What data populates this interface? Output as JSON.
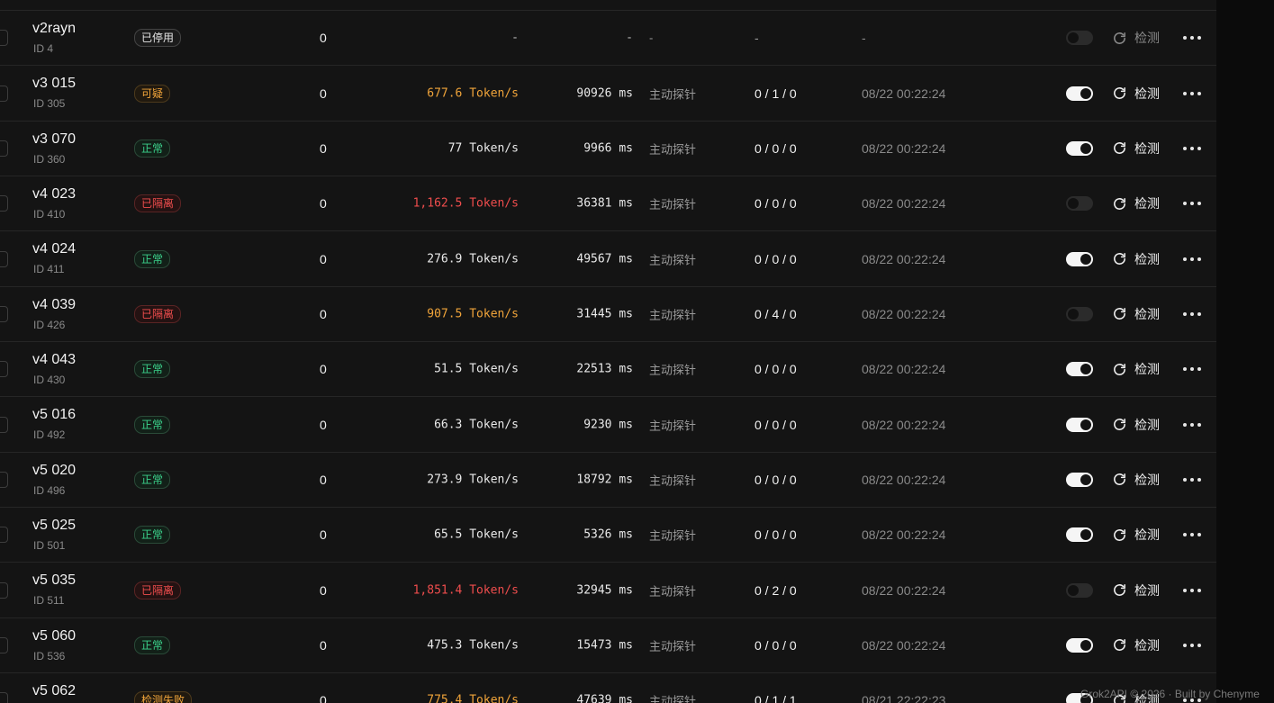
{
  "accounts": [
    {
      "name": "v2rayn",
      "id": "ID 4",
      "status": "已停用",
      "status_kind": "off",
      "count": "0",
      "speed": "-",
      "speed_kind": "dim",
      "latency": "-",
      "latency_kind": "dim",
      "method": "-",
      "ratio": "-",
      "ratio_kind": "dim",
      "time": "-",
      "enabled": false,
      "check_label": "检测",
      "check_disabled": true
    },
    {
      "name": "v3 015",
      "id": "ID 305",
      "status": "可疑",
      "status_kind": "sus",
      "count": "0",
      "speed": "677.6 Token/s",
      "speed_kind": "warn",
      "latency": "90926 ms",
      "latency_kind": "",
      "method": "主动探针",
      "ratio": "0 / 1 / 0",
      "ratio_kind": "",
      "time": "08/22 00:22:24",
      "enabled": true,
      "check_label": "检测",
      "check_disabled": false
    },
    {
      "name": "v3 070",
      "id": "ID 360",
      "status": "正常",
      "status_kind": "ok",
      "count": "0",
      "speed": "77 Token/s",
      "speed_kind": "",
      "latency": "9966 ms",
      "latency_kind": "",
      "method": "主动探针",
      "ratio": "0 / 0 / 0",
      "ratio_kind": "",
      "time": "08/22 00:22:24",
      "enabled": true,
      "check_label": "检测",
      "check_disabled": false
    },
    {
      "name": "v4 023",
      "id": "ID 410",
      "status": "已隔离",
      "status_kind": "iso",
      "count": "0",
      "speed": "1,162.5 Token/s",
      "speed_kind": "bad",
      "latency": "36381 ms",
      "latency_kind": "",
      "method": "主动探针",
      "ratio": "0 / 0 / 0",
      "ratio_kind": "",
      "time": "08/22 00:22:24",
      "enabled": false,
      "check_label": "检测",
      "check_disabled": false
    },
    {
      "name": "v4 024",
      "id": "ID 411",
      "status": "正常",
      "status_kind": "ok",
      "count": "0",
      "speed": "276.9 Token/s",
      "speed_kind": "",
      "latency": "49567 ms",
      "latency_kind": "",
      "method": "主动探针",
      "ratio": "0 / 0 / 0",
      "ratio_kind": "",
      "time": "08/22 00:22:24",
      "enabled": true,
      "check_label": "检测",
      "check_disabled": false
    },
    {
      "name": "v4 039",
      "id": "ID 426",
      "status": "已隔离",
      "status_kind": "iso",
      "count": "0",
      "speed": "907.5 Token/s",
      "speed_kind": "warn",
      "latency": "31445 ms",
      "latency_kind": "",
      "method": "主动探针",
      "ratio": "0 / 4 / 0",
      "ratio_kind": "",
      "time": "08/22 00:22:24",
      "enabled": false,
      "check_label": "检测",
      "check_disabled": false
    },
    {
      "name": "v4 043",
      "id": "ID 430",
      "status": "正常",
      "status_kind": "ok",
      "count": "0",
      "speed": "51.5 Token/s",
      "speed_kind": "",
      "latency": "22513 ms",
      "latency_kind": "",
      "method": "主动探针",
      "ratio": "0 / 0 / 0",
      "ratio_kind": "",
      "time": "08/22 00:22:24",
      "enabled": true,
      "check_label": "检测",
      "check_disabled": false
    },
    {
      "name": "v5 016",
      "id": "ID 492",
      "status": "正常",
      "status_kind": "ok",
      "count": "0",
      "speed": "66.3 Token/s",
      "speed_kind": "",
      "latency": "9230 ms",
      "latency_kind": "",
      "method": "主动探针",
      "ratio": "0 / 0 / 0",
      "ratio_kind": "",
      "time": "08/22 00:22:24",
      "enabled": true,
      "check_label": "检测",
      "check_disabled": false
    },
    {
      "name": "v5 020",
      "id": "ID 496",
      "status": "正常",
      "status_kind": "ok",
      "count": "0",
      "speed": "273.9 Token/s",
      "speed_kind": "",
      "latency": "18792 ms",
      "latency_kind": "",
      "method": "主动探针",
      "ratio": "0 / 0 / 0",
      "ratio_kind": "",
      "time": "08/22 00:22:24",
      "enabled": true,
      "check_label": "检测",
      "check_disabled": false
    },
    {
      "name": "v5 025",
      "id": "ID 501",
      "status": "正常",
      "status_kind": "ok",
      "count": "0",
      "speed": "65.5 Token/s",
      "speed_kind": "",
      "latency": "5326 ms",
      "latency_kind": "",
      "method": "主动探针",
      "ratio": "0 / 0 / 0",
      "ratio_kind": "",
      "time": "08/22 00:22:24",
      "enabled": true,
      "check_label": "检测",
      "check_disabled": false
    },
    {
      "name": "v5 035",
      "id": "ID 511",
      "status": "已隔离",
      "status_kind": "iso",
      "count": "0",
      "speed": "1,851.4 Token/s",
      "speed_kind": "bad",
      "latency": "32945 ms",
      "latency_kind": "",
      "method": "主动探针",
      "ratio": "0 / 2 / 0",
      "ratio_kind": "",
      "time": "08/22 00:22:24",
      "enabled": false,
      "check_label": "检测",
      "check_disabled": false
    },
    {
      "name": "v5 060",
      "id": "ID 536",
      "status": "正常",
      "status_kind": "ok",
      "count": "0",
      "speed": "475.3 Token/s",
      "speed_kind": "",
      "latency": "15473 ms",
      "latency_kind": "",
      "method": "主动探针",
      "ratio": "0 / 0 / 0",
      "ratio_kind": "",
      "time": "08/22 00:22:24",
      "enabled": true,
      "check_label": "检测",
      "check_disabled": false
    },
    {
      "name": "v5 062",
      "id": "",
      "status": "检测失败",
      "status_kind": "fail",
      "count": "0",
      "speed": "775.4 Token/s",
      "speed_kind": "warn",
      "latency": "47639 ms",
      "latency_kind": "",
      "method": "主动探针",
      "ratio": "0 / 1 / 1",
      "ratio_kind": "",
      "time": "08/21 22:22:23",
      "enabled": true,
      "check_label": "检测",
      "check_disabled": false
    }
  ],
  "footer": {
    "text": "Grok2API © 2026 · Built by Chenyme"
  }
}
